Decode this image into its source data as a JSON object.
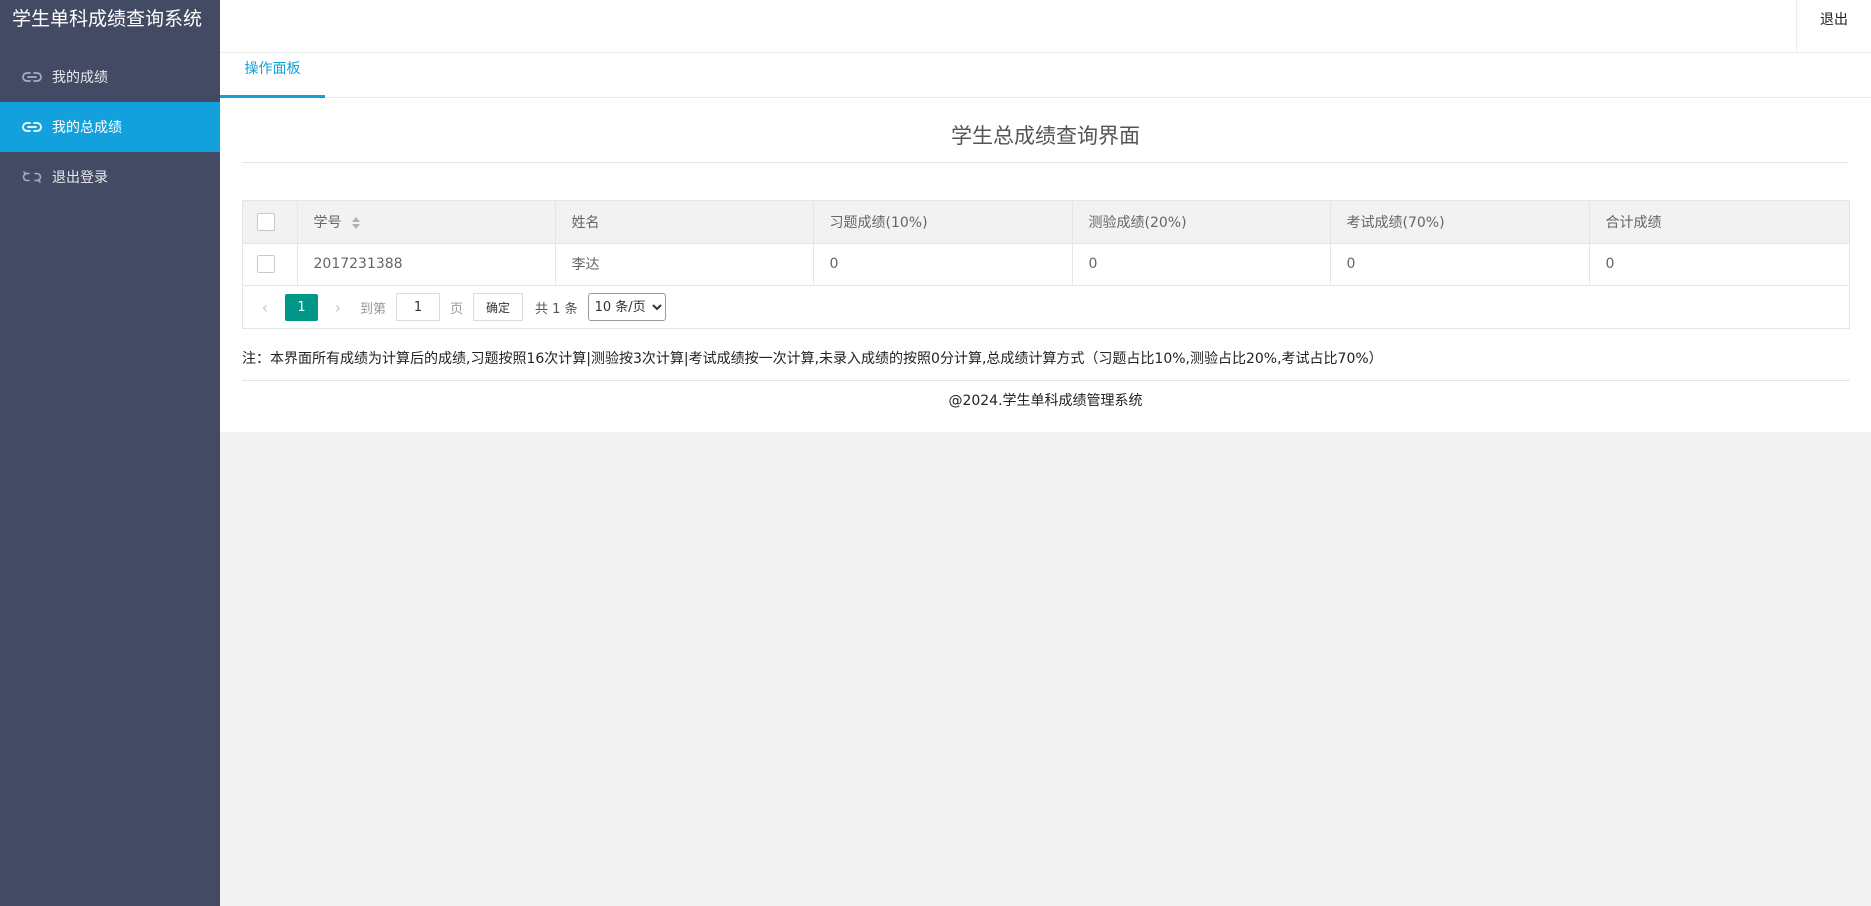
{
  "app": {
    "title": "学生单科成绩查询系统"
  },
  "sidebar": {
    "items": [
      {
        "label": "我的成绩",
        "icon": "link-icon",
        "active": false
      },
      {
        "label": "我的总成绩",
        "icon": "link-icon",
        "active": true
      },
      {
        "label": "退出登录",
        "icon": "unlink-icon",
        "active": false
      }
    ]
  },
  "header": {
    "logout_label": "退出"
  },
  "tabs": [
    {
      "label": "操作面板",
      "active": true
    }
  ],
  "main": {
    "title": "学生总成绩查询界面",
    "table": {
      "columns": [
        "学号",
        "姓名",
        "习题成绩(10%)",
        "测验成绩(20%)",
        "考试成绩(70%)",
        "合计成绩"
      ],
      "rows": [
        [
          "2017231388",
          "李达",
          "0",
          "0",
          "0",
          "0"
        ]
      ]
    },
    "pagination": {
      "current_page": "1",
      "goto_label": "到第",
      "goto_value": "1",
      "page_unit": "页",
      "confirm_label": "确定",
      "total_label": "共 1 条",
      "page_size_option": "10 条/页"
    },
    "note": "注：本界面所有成绩为计算后的成绩,习题按照16次计算|测验按3次计算|考试成绩按一次计算,未录入成绩的按照0分计算,总成绩计算方式（习题占比10%,测验占比20%,考试占比70%）",
    "footer": "@2024.学生单科成绩管理系统"
  },
  "colors": {
    "sidebar_bg": "#434a63",
    "accent": "#12a1dc",
    "page_active": "#009688"
  }
}
